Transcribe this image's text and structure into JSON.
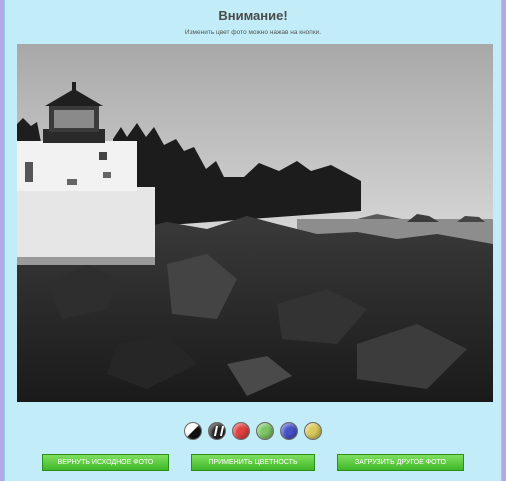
{
  "dialog": {
    "title": "Внимание!",
    "subtitle": "Изменить цвет фото можно нажав на кнопки."
  },
  "swatches": [
    {
      "name": "black-white",
      "color": "#ffffff/#111111"
    },
    {
      "name": "inverse",
      "color": "#222222"
    },
    {
      "name": "red",
      "color": "#e0403e"
    },
    {
      "name": "green",
      "color": "#7cc464"
    },
    {
      "name": "blue",
      "color": "#4650c8"
    },
    {
      "name": "yellow",
      "color": "#d9c85a"
    }
  ],
  "buttons": {
    "restore": "Вернуть исходное фото",
    "apply": "Применить цветность",
    "upload": "Загрузить другое фото"
  },
  "colors": {
    "panel_bg": "#c2ecf8",
    "button_green": "#4fc432",
    "page_bg": "#b5a7e6"
  }
}
